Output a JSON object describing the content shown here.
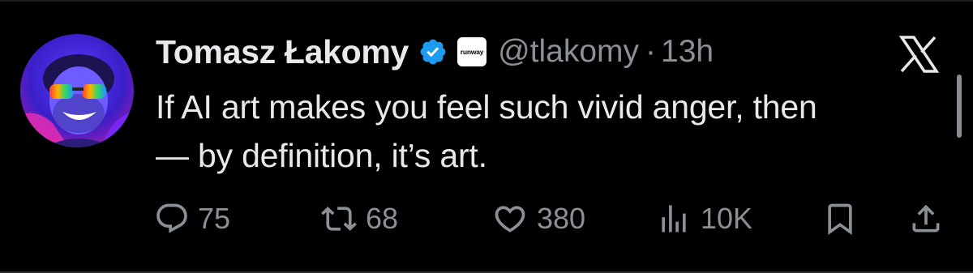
{
  "author": {
    "name": "Tomasz Łakomy",
    "handle": "@tlakomy",
    "separator": "·",
    "time": "13h",
    "affiliate_label": "runway"
  },
  "tweet": {
    "line1": "If AI art makes you feel such vivid anger, then",
    "line2": "— by definition, it’s art."
  },
  "actions": {
    "replies": "75",
    "reposts": "68",
    "likes": "380",
    "views": "10K"
  },
  "icons": {
    "verified": "verified-badge-icon",
    "logo": "x-logo-icon",
    "reply": "reply-icon",
    "repost": "repost-icon",
    "like": "heart-icon",
    "views": "views-icon",
    "bookmark": "bookmark-icon",
    "share": "share-icon"
  },
  "colors": {
    "background": "#000000",
    "text": "#e7e9ea",
    "secondary": "#8b9096",
    "verified": "#1d9bf0"
  }
}
